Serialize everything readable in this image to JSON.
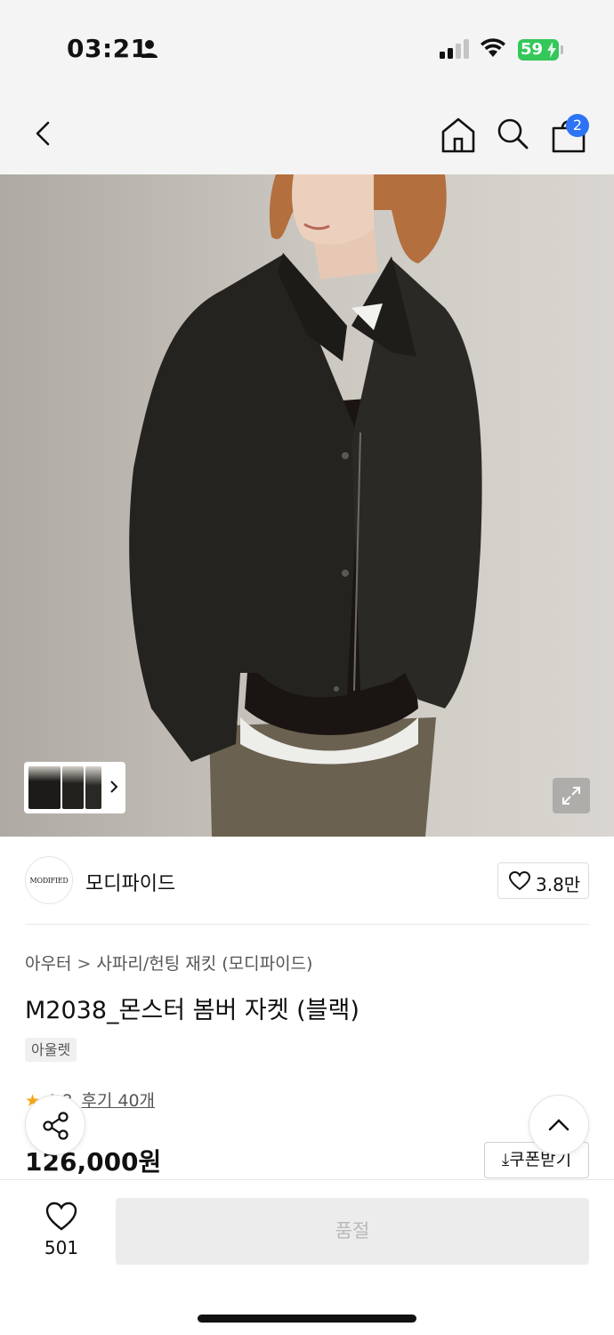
{
  "status_bar": {
    "time": "03:21",
    "battery": "59"
  },
  "nav": {
    "cart_count": "2",
    "icons": [
      "back-icon",
      "home-icon",
      "search-icon",
      "cart-icon"
    ]
  },
  "brand": {
    "logo_text": "MODIFIED",
    "name": "모디파이드",
    "likes": "3.8만"
  },
  "product": {
    "breadcrumb": [
      "아우터",
      "사파리/헌팅 재킷 (모디파이드)"
    ],
    "title": "M2038_몬스터 봄버 자켓 (블랙)",
    "tag": "아울렛",
    "rating_prefix": "4.8",
    "reviews": "후기 40개",
    "price": "126,000원",
    "coupon_label": "⤓쿠폰받기"
  },
  "bottom_bar": {
    "wish_count": "501",
    "buy_label": "품절"
  },
  "colors": {
    "accent_badge": "#2c73f5",
    "battery": "#34c759",
    "star": "#f7a418",
    "soldout_bg": "#ececec"
  }
}
